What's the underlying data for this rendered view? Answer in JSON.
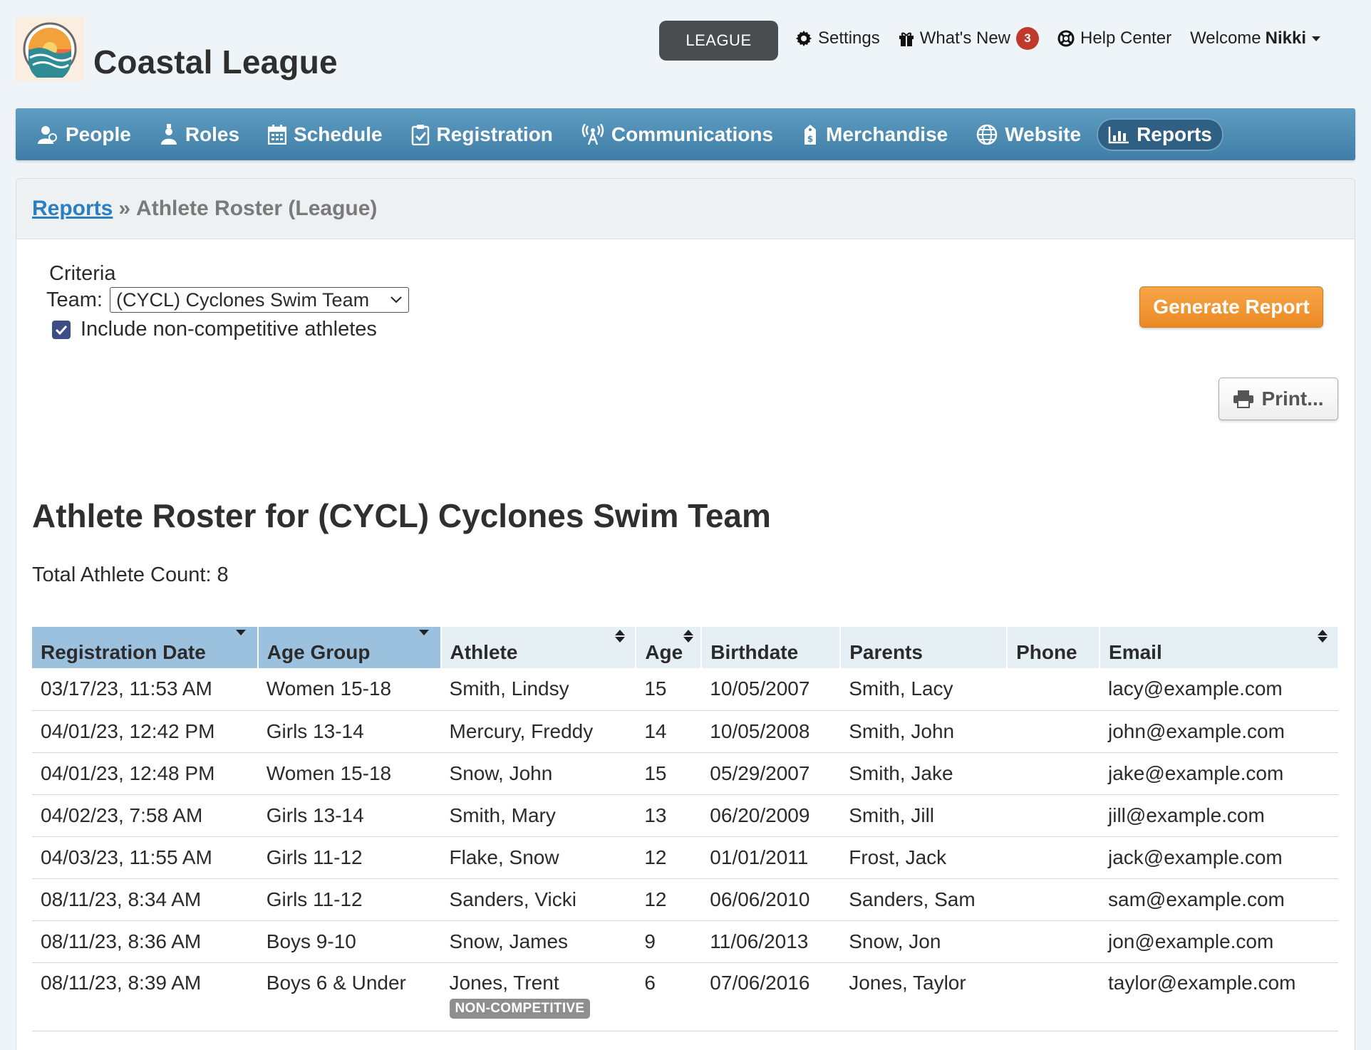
{
  "header": {
    "brand": "Coastal League",
    "league_button": "LEAGUE",
    "settings": "Settings",
    "whats_new": "What's New",
    "whats_new_count": "3",
    "help_center": "Help Center",
    "welcome_prefix": "Welcome",
    "user_name": "Nikki"
  },
  "nav": {
    "people": "People",
    "roles": "Roles",
    "schedule": "Schedule",
    "registration": "Registration",
    "communications": "Communications",
    "merchandise": "Merchandise",
    "website": "Website",
    "reports": "Reports"
  },
  "breadcrumb": {
    "parent": "Reports",
    "separator": "»",
    "current": "Athlete Roster (League)"
  },
  "criteria": {
    "label": "Criteria",
    "team_label": "Team:",
    "team_value": "(CYCL) Cyclones Swim Team",
    "include_noncompetitive_label": "Include non-competitive athletes",
    "include_noncompetitive_checked": true
  },
  "actions": {
    "generate": "Generate Report",
    "print": "Print..."
  },
  "report": {
    "title": "Athlete Roster for (CYCL) Cyclones Swim Team",
    "total_count": "Total Athlete Count: 8"
  },
  "table": {
    "headers": {
      "registration_date": "Registration Date",
      "age_group": "Age Group",
      "athlete": "Athlete",
      "age": "Age",
      "birthdate": "Birthdate",
      "parents": "Parents",
      "phone": "Phone",
      "email": "Email"
    },
    "rows": [
      {
        "registration_date": "03/17/23, 11:53 AM",
        "age_group": "Women 15-18",
        "athlete": "Smith, Lindsy",
        "age": "15",
        "birthdate": "10/05/2007",
        "parents": "Smith, Lacy",
        "phone": "",
        "email": "lacy@example.com"
      },
      {
        "registration_date": "04/01/23, 12:42 PM",
        "age_group": "Girls 13-14",
        "athlete": "Mercury, Freddy",
        "age": "14",
        "birthdate": "10/05/2008",
        "parents": "Smith, John",
        "phone": "",
        "email": "john@example.com"
      },
      {
        "registration_date": "04/01/23, 12:48 PM",
        "age_group": "Women 15-18",
        "athlete": "Snow, John",
        "age": "15",
        "birthdate": "05/29/2007",
        "parents": "Smith, Jake",
        "phone": "",
        "email": "jake@example.com"
      },
      {
        "registration_date": "04/02/23, 7:58 AM",
        "age_group": "Girls 13-14",
        "athlete": "Smith, Mary",
        "age": "13",
        "birthdate": "06/20/2009",
        "parents": "Smith, Jill",
        "phone": "",
        "email": "jill@example.com"
      },
      {
        "registration_date": "04/03/23, 11:55 AM",
        "age_group": "Girls 11-12",
        "athlete": "Flake, Snow",
        "age": "12",
        "birthdate": "01/01/2011",
        "parents": "Frost, Jack",
        "phone": "",
        "email": "jack@example.com"
      },
      {
        "registration_date": "08/11/23, 8:34 AM",
        "age_group": "Girls 11-12",
        "athlete": "Sanders, Vicki",
        "age": "12",
        "birthdate": "06/06/2010",
        "parents": "Sanders, Sam",
        "phone": "",
        "email": "sam@example.com"
      },
      {
        "registration_date": "08/11/23, 8:36 AM",
        "age_group": "Boys 9-10",
        "athlete": "Snow, James",
        "age": "9",
        "birthdate": "11/06/2013",
        "parents": "Snow, Jon",
        "phone": "",
        "email": "jon@example.com"
      },
      {
        "registration_date": "08/11/23, 8:39 AM",
        "age_group": "Boys 6 & Under",
        "athlete": "Jones, Trent",
        "athlete_badge": "NON-COMPETITIVE",
        "age": "6",
        "birthdate": "07/06/2016",
        "parents": "Jones, Taylor",
        "phone": "",
        "email": "taylor@example.com"
      }
    ]
  },
  "colors": {
    "nav_bar": "#4a8ab3",
    "accent_orange": "#f0952e",
    "link_blue": "#2a7fc0",
    "sorted_header": "#9cc1de",
    "badge_red": "#c0392b"
  }
}
